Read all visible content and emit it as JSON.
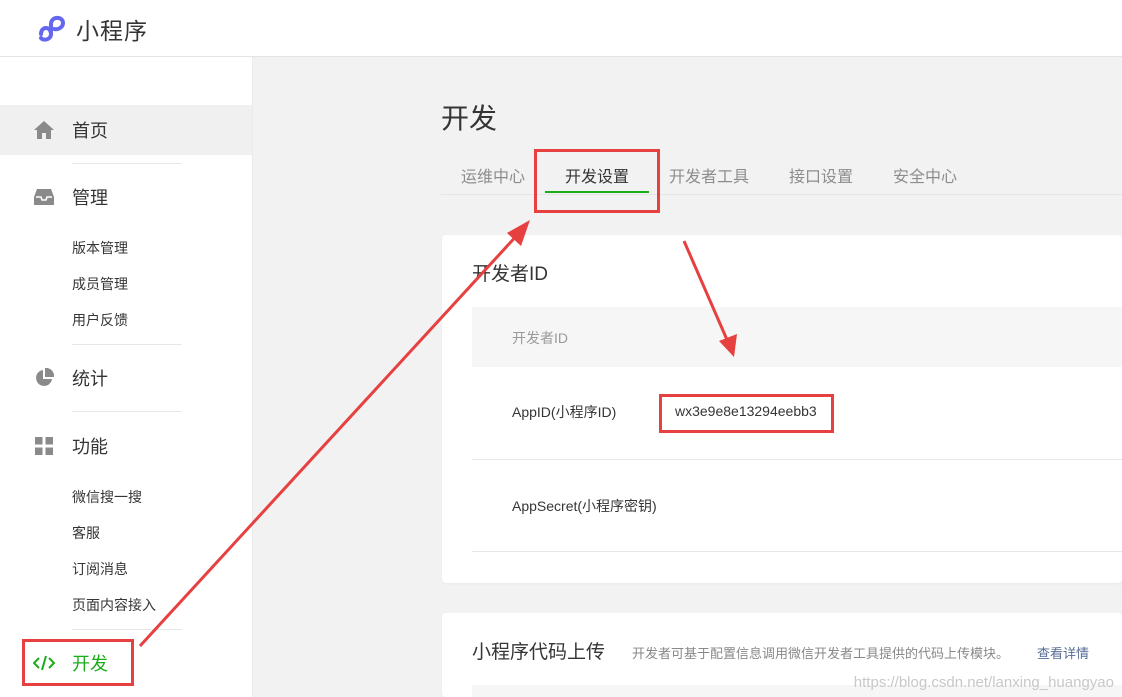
{
  "app": {
    "name": "小程序"
  },
  "sidebar": {
    "home_label": "首页",
    "manage": {
      "label": "管理",
      "items": [
        "版本管理",
        "成员管理",
        "用户反馈"
      ]
    },
    "stats_label": "统计",
    "features": {
      "label": "功能",
      "items": [
        "微信搜一搜",
        "客服",
        "订阅消息",
        "页面内容接入"
      ]
    },
    "dev_label": "开发"
  },
  "main": {
    "title": "开发",
    "tabs": [
      "运维中心",
      "开发设置",
      "开发者工具",
      "接口设置",
      "安全中心"
    ],
    "active_tab": "开发设置",
    "dev_id_card": {
      "title": "开发者ID",
      "header": "开发者ID",
      "rows": [
        {
          "label": "AppID(小程序ID)",
          "value": "wx3e9e8e13294eebb3"
        },
        {
          "label": "AppSecret(小程序密钥)",
          "value": ""
        }
      ]
    },
    "upload_card": {
      "title": "小程序代码上传",
      "description": "开发者可基于配置信息调用微信开发者工具提供的代码上传模块。",
      "link": "查看详情"
    }
  },
  "watermark": "https://blog.csdn.net/lanxing_huangyao",
  "colors": {
    "accent": "#1aad19",
    "annotation": "#e64040",
    "link": "#576b95"
  }
}
